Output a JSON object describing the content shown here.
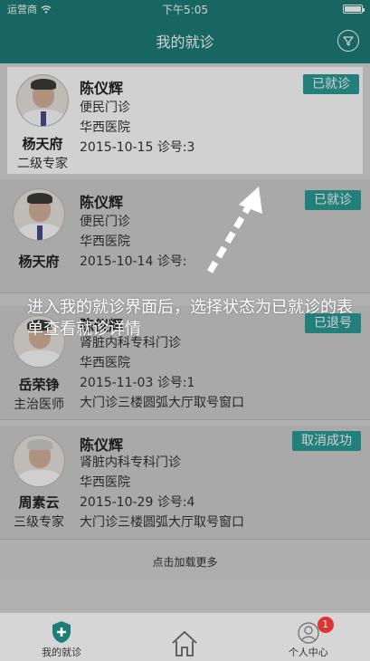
{
  "status_bar": {
    "carrier": "运营商",
    "time": "下午5:05"
  },
  "navbar": {
    "title": "我的就诊",
    "filter_icon": "filter-icon"
  },
  "appointments": [
    {
      "patient": "陈仪辉",
      "department": "便民门诊",
      "hospital": "华西医院",
      "date": "2015-10-15",
      "queue": "诊号:3",
      "location": "",
      "doctor": "杨天府",
      "doctor_title": "二级专家",
      "status": "已就诊"
    },
    {
      "patient": "陈仪辉",
      "department": "便民门诊",
      "hospital": "华西医院",
      "date": "2015-10-14",
      "queue": "诊号:",
      "location": "",
      "doctor": "杨天府",
      "doctor_title": "",
      "status": "已就诊"
    },
    {
      "patient": "陈仪辉",
      "department": "肾脏内科专科门诊",
      "hospital": "华西医院",
      "date": "2015-11-03",
      "queue": "诊号:1",
      "location": "大门诊三楼圆弧大厅取号窗口",
      "doctor": "岳荣铮",
      "doctor_title": "主治医师",
      "status": "已退号"
    },
    {
      "patient": "陈仪辉",
      "department": "肾脏内科专科门诊",
      "hospital": "华西医院",
      "date": "2015-10-29",
      "queue": "诊号:4",
      "location": "大门诊三楼圆弧大厅取号窗口",
      "doctor": "周素云",
      "doctor_title": "三级专家",
      "status": "取消成功"
    }
  ],
  "load_more": "点击加载更多",
  "guide_tip": "进入我的就诊界面后，选择状态为已就诊的表单查看就诊详情",
  "tabbar": {
    "tabs": [
      {
        "label": "我的就诊",
        "icon": "shield-plus-icon"
      },
      {
        "label": "",
        "icon": "home-icon"
      },
      {
        "label": "个人中心",
        "icon": "user-icon",
        "badge": "1"
      }
    ]
  },
  "colors": {
    "primary": "#1d7d78",
    "status_badge": "#2a9c95"
  }
}
